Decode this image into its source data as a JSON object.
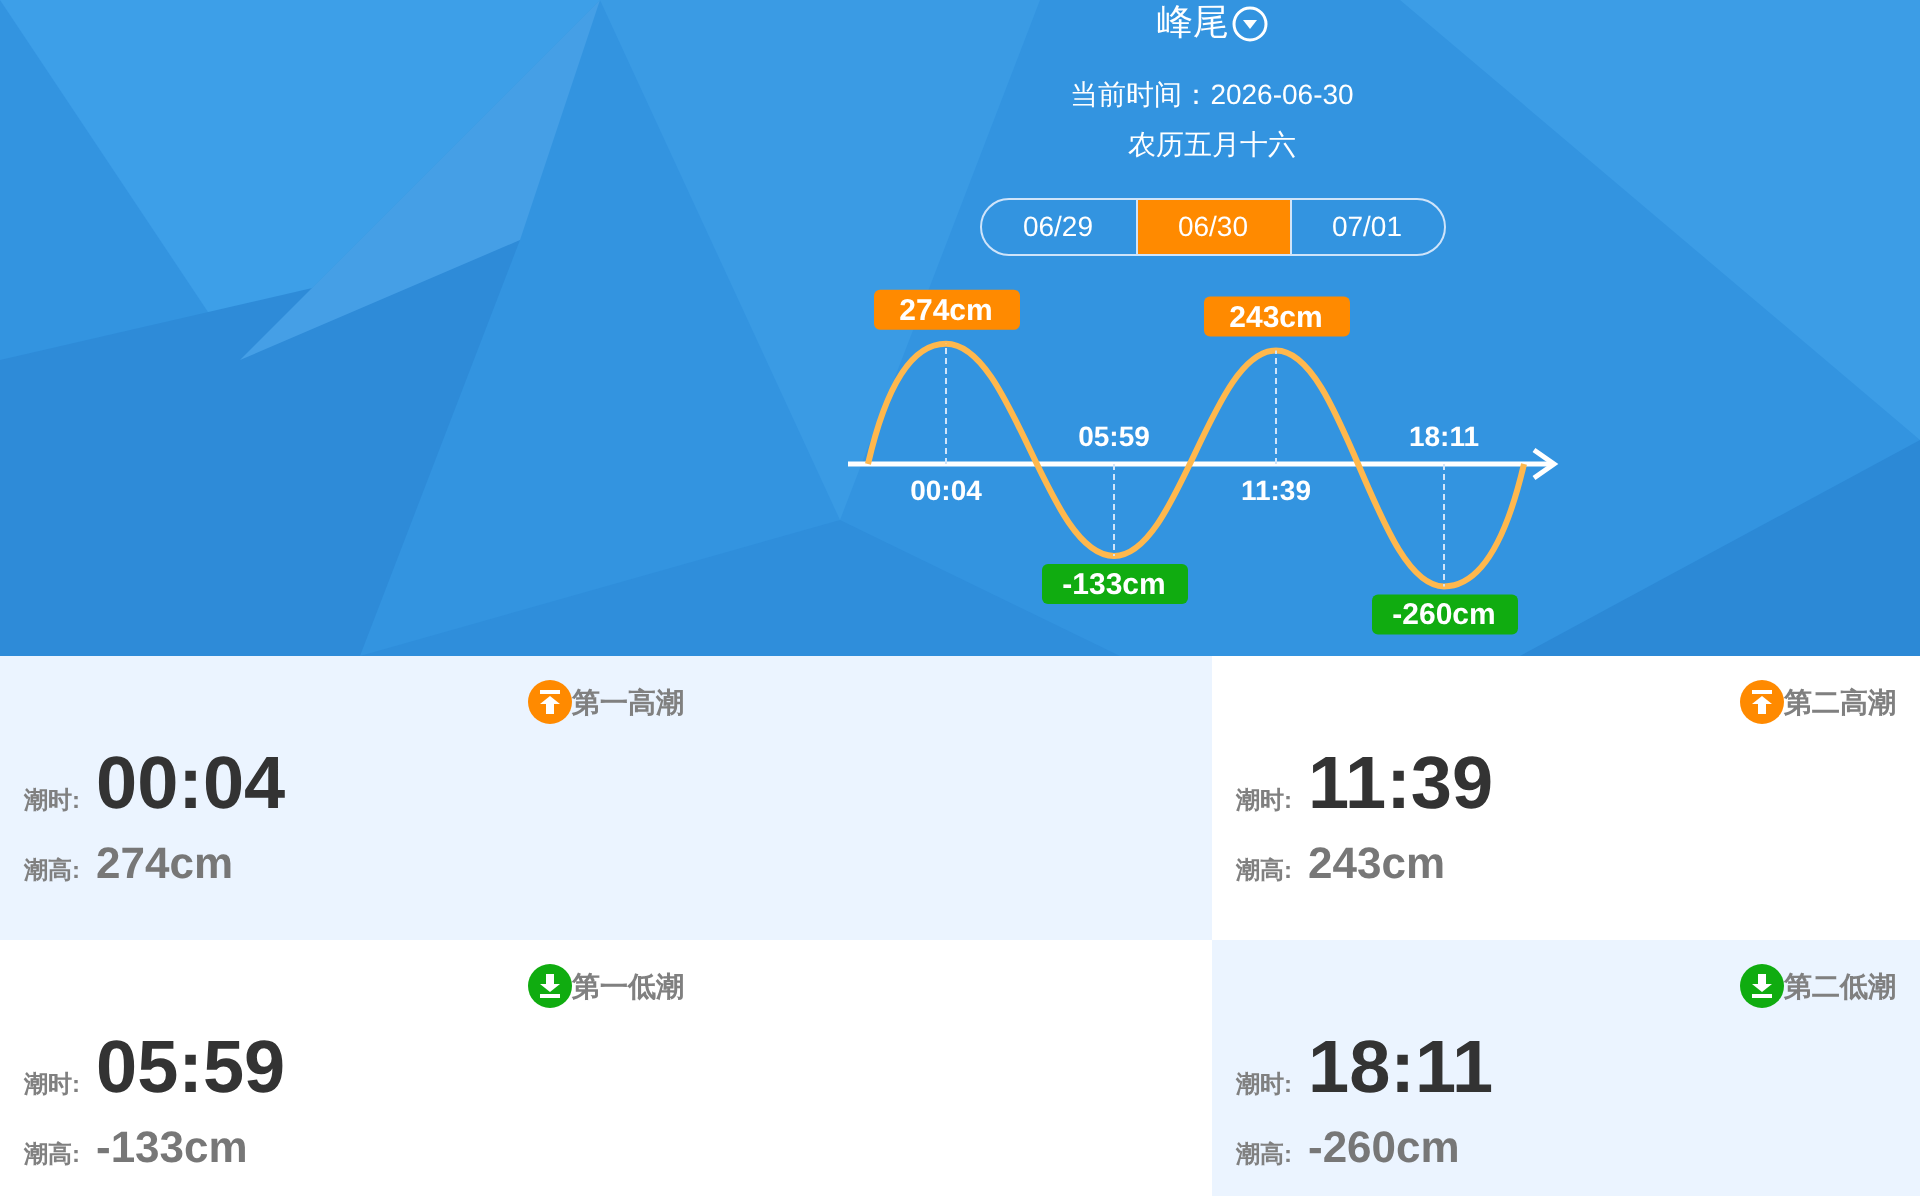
{
  "header": {
    "location": "峰尾",
    "current_time": "当前时间：2026-06-30",
    "lunar_date": "农历五月十六"
  },
  "date_tabs": [
    {
      "label": "06/29",
      "selected": false
    },
    {
      "label": "06/30",
      "selected": true
    },
    {
      "label": "07/01",
      "selected": false
    }
  ],
  "tide_drawing": [
    {
      "kind": "high",
      "time": "00:04",
      "height": "274cm"
    },
    {
      "kind": "low",
      "time": "05:59",
      "height": "-133cm"
    },
    {
      "kind": "high",
      "time": "11:39",
      "height": "243cm"
    },
    {
      "kind": "low",
      "time": "18:11",
      "height": "-260cm"
    }
  ],
  "tide_cards": [
    {
      "kind": "high",
      "shaded": true,
      "title": "第一高潮",
      "time_label": "潮时:",
      "time": "00:04",
      "height_label": "潮高:",
      "height": "274cm"
    },
    {
      "kind": "high",
      "shaded": false,
      "title": "第二高潮",
      "time_label": "潮时:",
      "time": "11:39",
      "height_label": "潮高:",
      "height": "243cm"
    },
    {
      "kind": "low",
      "shaded": false,
      "title": "第一低潮",
      "time_label": "潮时:",
      "time": "05:59",
      "height_label": "潮高:",
      "height": "-133cm"
    },
    {
      "kind": "low",
      "shaded": true,
      "title": "第二低潮",
      "time_label": "潮时:",
      "time": "18:11",
      "height_label": "潮高:",
      "height": "-260cm"
    }
  ]
}
